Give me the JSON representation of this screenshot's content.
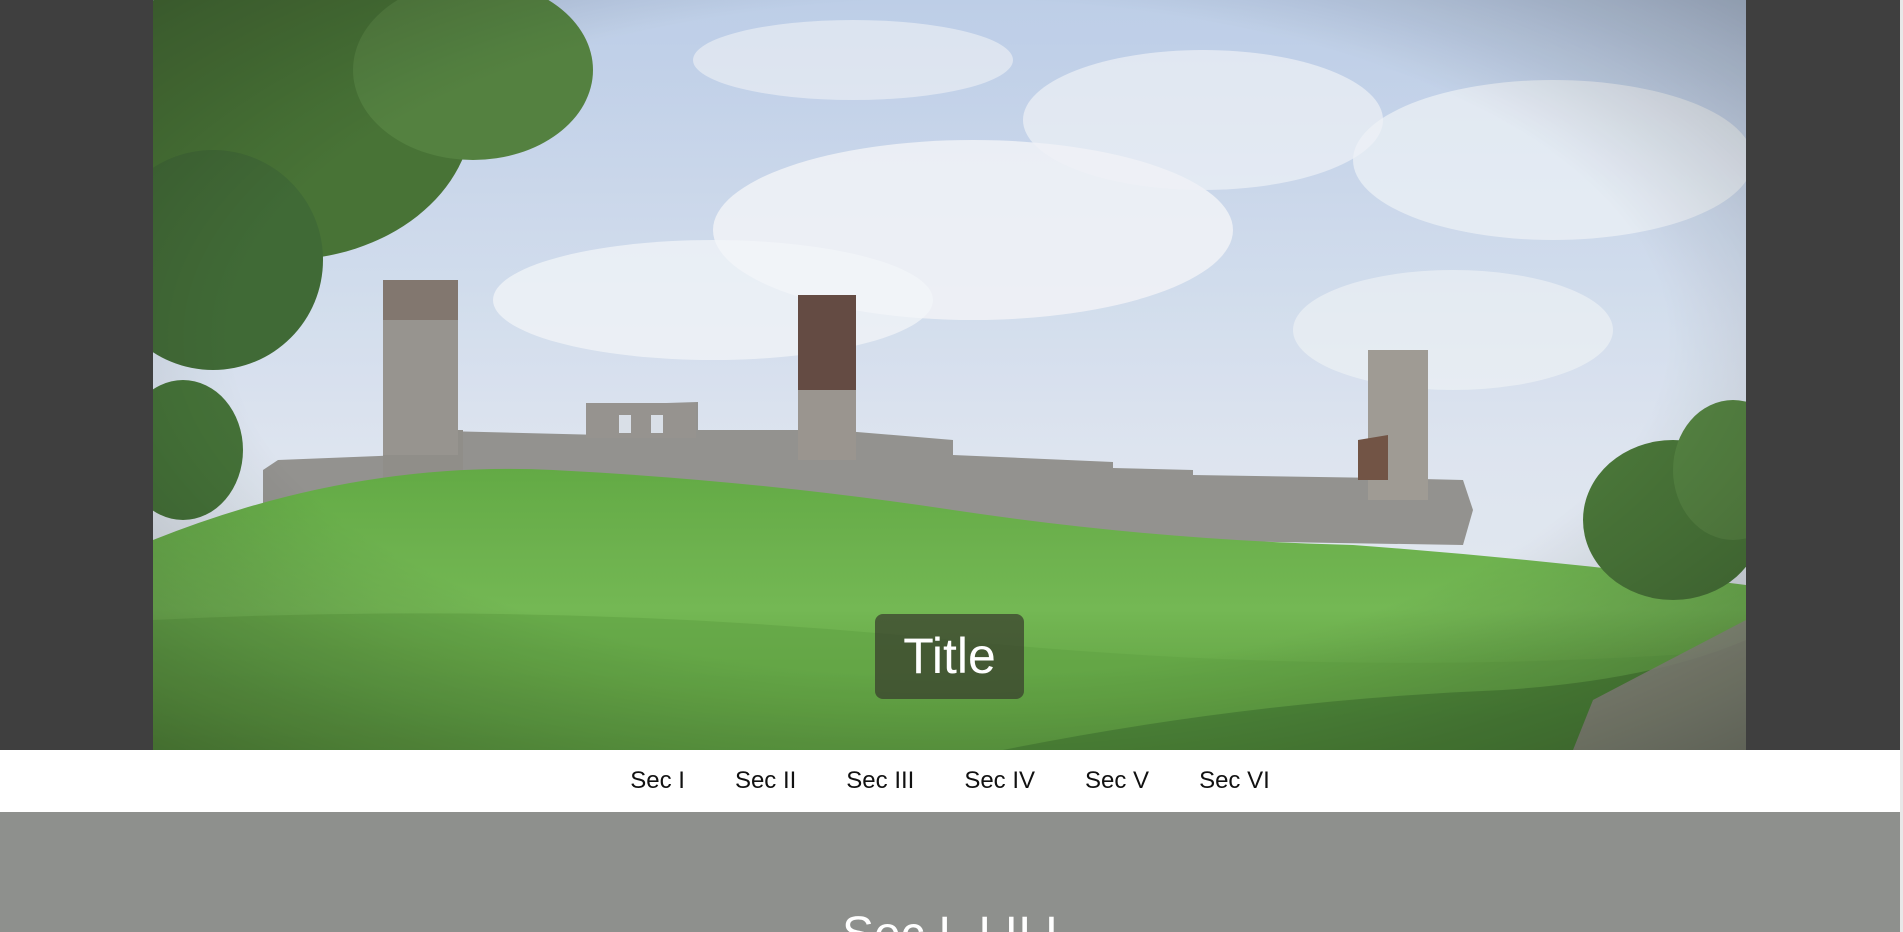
{
  "hero": {
    "title": "Title",
    "image_alt": "castle-ruins-on-green-hill"
  },
  "nav": {
    "items": [
      {
        "label": "Sec I"
      },
      {
        "label": "Sec II"
      },
      {
        "label": "Sec III"
      },
      {
        "label": "Sec IV"
      },
      {
        "label": "Sec V"
      },
      {
        "label": "Sec VI"
      }
    ]
  },
  "section": {
    "title": "Sec I. I II I"
  },
  "colors": {
    "page_background": "#3f3f3f",
    "nav_background": "#ffffff",
    "section_background": "#8e908d",
    "title_badge": "#373c2d"
  }
}
